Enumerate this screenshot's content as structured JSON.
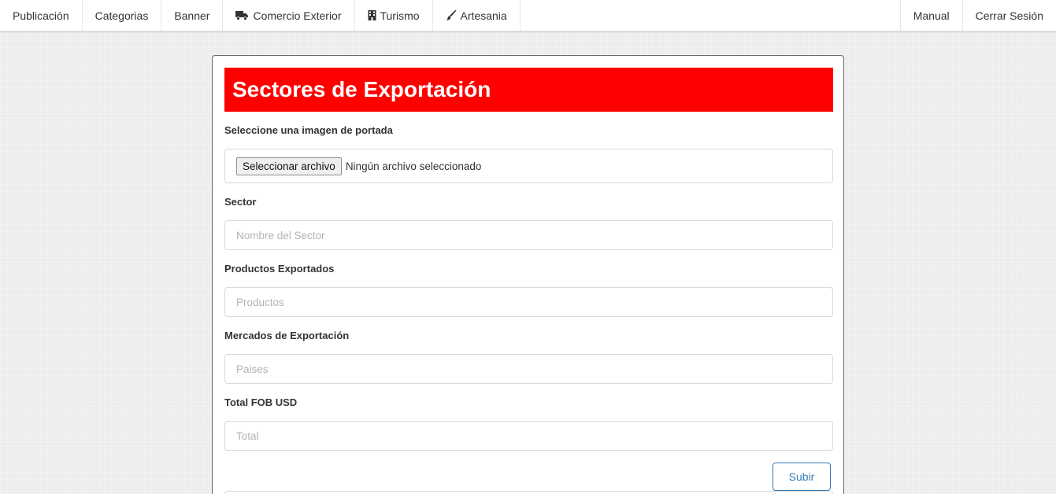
{
  "navbar": {
    "left_items": [
      {
        "label": "Publicación",
        "icon": ""
      },
      {
        "label": "Categorias",
        "icon": ""
      },
      {
        "label": "Banner",
        "icon": ""
      },
      {
        "label": "Comercio Exterior",
        "icon": "truck-icon"
      },
      {
        "label": "Turismo",
        "icon": "building-icon"
      },
      {
        "label": "Artesania",
        "icon": "paintbrush-icon"
      }
    ],
    "right_items": [
      {
        "label": "Manual"
      },
      {
        "label": "Cerrar Sesión"
      }
    ]
  },
  "form": {
    "title": "Sectores de Exportación",
    "title_bg_color": "#ff0000",
    "cover_label": "Seleccione una imagen de portada",
    "file_button_label": "Seleccionar archivo",
    "file_status": "Ningún archivo seleccionado",
    "sector_label": "Sector",
    "sector_placeholder": "Nombre del Sector",
    "sector_value": "",
    "products_label": "Productos Exportados",
    "products_placeholder": "Productos",
    "products_value": "",
    "markets_label": "Mercados de Exportación",
    "markets_placeholder": "Paises",
    "markets_value": "",
    "total_label": "Total FOB USD",
    "total_placeholder": "Total",
    "total_value": "",
    "submit_label": "Subir",
    "submit_color": "#337ab7"
  }
}
